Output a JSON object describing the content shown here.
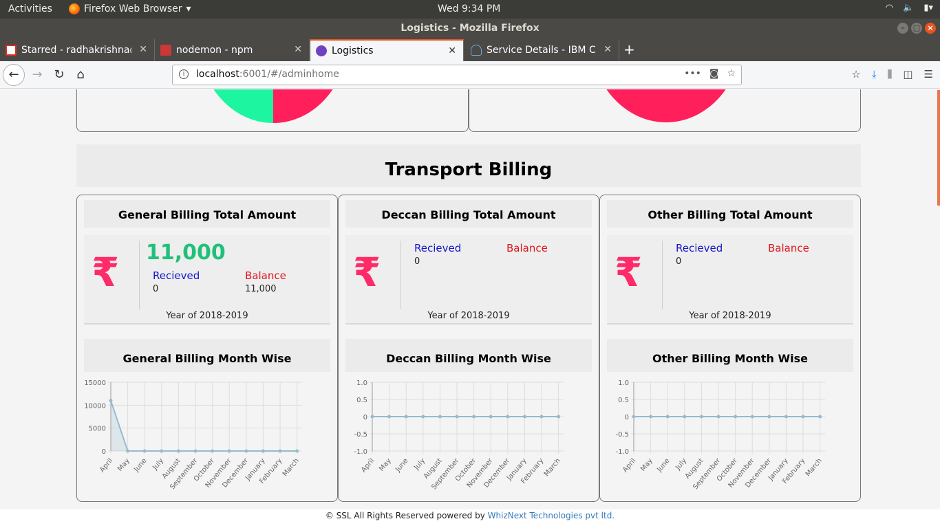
{
  "system": {
    "activities": "Activities",
    "app_name": "Firefox Web Browser",
    "clock": "Wed  9:34 PM"
  },
  "window": {
    "title": "Logistics - Mozilla Firefox"
  },
  "tabs": [
    {
      "title": "Starred - radhakrishna@",
      "icon": "gmail-icon",
      "active": false
    },
    {
      "title": "nodemon - npm",
      "icon": "npm-icon",
      "active": false
    },
    {
      "title": "Logistics",
      "icon": "logistics-icon",
      "active": true
    },
    {
      "title": "Service Details - IBM Clo",
      "icon": "ibm-cloud-icon",
      "active": false
    }
  ],
  "urlbar": {
    "host": "localhost",
    "path": ":6001/#/adminhome"
  },
  "section": {
    "title": "Transport Billing"
  },
  "cards": [
    {
      "title": "General Billing Total Amount",
      "amount": "11,000",
      "received_label": "Recieved",
      "received_value": "0",
      "balance_label": "Balance",
      "balance_value": "11,000",
      "year": "Year of 2018-2019",
      "month_title": "General Billing Month Wise"
    },
    {
      "title": "Deccan Billing Total Amount",
      "amount": "",
      "received_label": "Recieved",
      "received_value": "0",
      "balance_label": "Balance",
      "balance_value": "",
      "year": "Year of 2018-2019",
      "month_title": "Deccan Billing Month Wise"
    },
    {
      "title": "Other Billing Total Amount",
      "amount": "",
      "received_label": "Recieved",
      "received_value": "0",
      "balance_label": "Balance",
      "balance_value": "",
      "year": "Year of 2018-2019",
      "month_title": "Other Billing Month Wise"
    }
  ],
  "chart_data": [
    {
      "type": "area",
      "categories": [
        "April",
        "May",
        "June",
        "July",
        "August",
        "September",
        "October",
        "November",
        "December",
        "January",
        "February",
        "March"
      ],
      "series": [
        {
          "values": [
            11000,
            0,
            0,
            0,
            0,
            0,
            0,
            0,
            0,
            0,
            0,
            0
          ]
        }
      ],
      "ylim": [
        0,
        15000
      ],
      "yticks": [
        "0",
        "5000",
        "10000",
        "15000"
      ],
      "grid": true
    },
    {
      "type": "line",
      "categories": [
        "April",
        "May",
        "June",
        "July",
        "August",
        "September",
        "October",
        "November",
        "December",
        "January",
        "February",
        "March"
      ],
      "series": [
        {
          "values": [
            0,
            0,
            0,
            0,
            0,
            0,
            0,
            0,
            0,
            0,
            0,
            0
          ]
        }
      ],
      "ylim": [
        -1,
        1
      ],
      "yticks": [
        "-1.0",
        "-0.5",
        "0",
        "0.5",
        "1.0"
      ],
      "grid": true
    },
    {
      "type": "line",
      "categories": [
        "April",
        "May",
        "June",
        "July",
        "August",
        "September",
        "October",
        "November",
        "December",
        "January",
        "February",
        "March"
      ],
      "series": [
        {
          "values": [
            0,
            0,
            0,
            0,
            0,
            0,
            0,
            0,
            0,
            0,
            0,
            0
          ]
        }
      ],
      "ylim": [
        -1,
        1
      ],
      "yticks": [
        "-1.0",
        "-0.5",
        "0",
        "0.5",
        "1.0"
      ],
      "grid": true
    }
  ],
  "colors": {
    "rupee": "#ff2a68",
    "amount": "#21c07a",
    "received": "#1515c8",
    "balance": "#e0141e",
    "pie_green": "#1ef5a0",
    "pie_red": "#ff1f5b",
    "line": "#97bbcd"
  },
  "footer": {
    "text": "© SSL All Rights Reserved powered by",
    "link": "WhizNext Technologies pvt ltd."
  }
}
